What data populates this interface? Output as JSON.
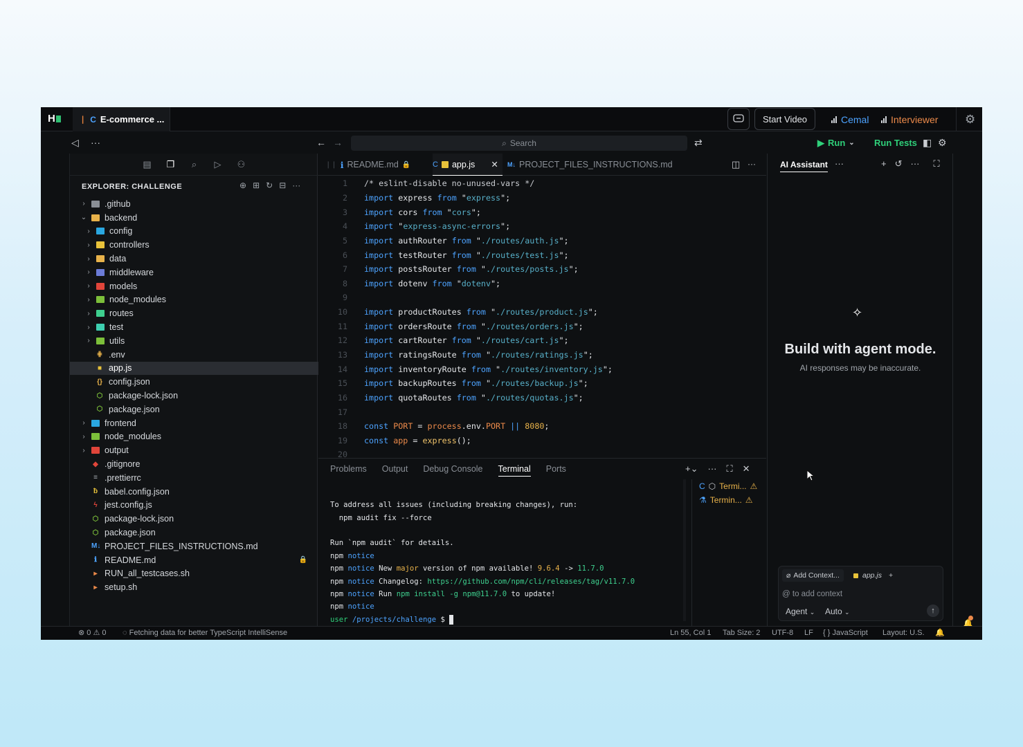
{
  "window": {
    "project_tab": "E-commerce ...",
    "start_video": "Start Video",
    "user1": "Cemal",
    "user2": "Interviewer",
    "colors": {
      "user1": "#4da3ff",
      "user2": "#ec8a4a",
      "run": "#2fd07a"
    }
  },
  "toolbar": {
    "search_placeholder": "Search",
    "run_label": "Run",
    "run_tests_label": "Run Tests"
  },
  "explorer": {
    "title": "EXPLORER: CHALLENGE",
    "items": [
      {
        "label": ".github",
        "depth": 0,
        "type": "folder",
        "expanded": false,
        "color": "#8a8f96"
      },
      {
        "label": "backend",
        "depth": 0,
        "type": "folder",
        "expanded": true,
        "color": "#e8b24a"
      },
      {
        "label": "config",
        "depth": 1,
        "type": "folder",
        "expanded": false,
        "color": "#2aa7e0"
      },
      {
        "label": "controllers",
        "depth": 1,
        "type": "folder",
        "expanded": false,
        "color": "#e8c23a"
      },
      {
        "label": "data",
        "depth": 1,
        "type": "folder",
        "expanded": false,
        "color": "#e8b24a"
      },
      {
        "label": "middleware",
        "depth": 1,
        "type": "folder",
        "expanded": false,
        "color": "#6b7bd6"
      },
      {
        "label": "models",
        "depth": 1,
        "type": "folder",
        "expanded": false,
        "color": "#e0453a"
      },
      {
        "label": "node_modules",
        "depth": 1,
        "type": "folder",
        "expanded": false,
        "color": "#7cbf3a"
      },
      {
        "label": "routes",
        "depth": 1,
        "type": "folder",
        "expanded": false,
        "color": "#3ecf8e"
      },
      {
        "label": "test",
        "depth": 1,
        "type": "folder",
        "expanded": false,
        "color": "#3ecfb0"
      },
      {
        "label": "utils",
        "depth": 1,
        "type": "folder",
        "expanded": false,
        "color": "#7cbf3a"
      },
      {
        "label": ".env",
        "depth": 1,
        "type": "file",
        "glyph": "⋕",
        "color": "#e8b24a"
      },
      {
        "label": "app.js",
        "depth": 1,
        "type": "file",
        "glyph": "■",
        "color": "#e8c23a",
        "selected": true
      },
      {
        "label": "config.json",
        "depth": 1,
        "type": "file",
        "glyph": "{}",
        "color": "#e8b24a"
      },
      {
        "label": "package-lock.json",
        "depth": 1,
        "type": "file",
        "glyph": "⬡",
        "color": "#7cbf3a"
      },
      {
        "label": "package.json",
        "depth": 1,
        "type": "file",
        "glyph": "⬡",
        "color": "#7cbf3a"
      },
      {
        "label": "frontend",
        "depth": 0,
        "type": "folder",
        "expanded": false,
        "color": "#2aa7e0"
      },
      {
        "label": "node_modules",
        "depth": 0,
        "type": "folder",
        "expanded": false,
        "color": "#7cbf3a"
      },
      {
        "label": "output",
        "depth": 0,
        "type": "folder",
        "expanded": false,
        "color": "#e0453a"
      },
      {
        "label": ".gitignore",
        "depth": 0,
        "type": "file",
        "glyph": "◆",
        "color": "#e0453a"
      },
      {
        "label": ".prettierrc",
        "depth": 0,
        "type": "file",
        "glyph": "≡",
        "color": "#a0a5ab"
      },
      {
        "label": "babel.config.json",
        "depth": 0,
        "type": "file",
        "glyph": "ƀ",
        "color": "#e8c23a"
      },
      {
        "label": "jest.config.js",
        "depth": 0,
        "type": "file",
        "glyph": "ϟ",
        "color": "#e0453a"
      },
      {
        "label": "package-lock.json",
        "depth": 0,
        "type": "file",
        "glyph": "⬡",
        "color": "#7cbf3a"
      },
      {
        "label": "package.json",
        "depth": 0,
        "type": "file",
        "glyph": "⬡",
        "color": "#7cbf3a"
      },
      {
        "label": "PROJECT_FILES_INSTRUCTIONS.md",
        "depth": 0,
        "type": "file",
        "glyph": "M↓",
        "color": "#4da3ff"
      },
      {
        "label": "README.md",
        "depth": 0,
        "type": "file",
        "glyph": "ℹ",
        "color": "#4da3ff",
        "locked": true
      },
      {
        "label": "RUN_all_testcases.sh",
        "depth": 0,
        "type": "file",
        "glyph": "▸",
        "color": "#ec8a4a"
      },
      {
        "label": "setup.sh",
        "depth": 0,
        "type": "file",
        "glyph": "▸",
        "color": "#ec8a4a"
      }
    ]
  },
  "editor": {
    "tabs": [
      {
        "label": "README.md",
        "active": false
      },
      {
        "label": "app.js",
        "active": true
      },
      {
        "label": "PROJECT_FILES_INSTRUCTIONS.md",
        "active": false
      }
    ],
    "lines": [
      [
        [
          "cm",
          "/* eslint-disable no-unused-vars */"
        ]
      ],
      [
        [
          "kw",
          "import"
        ],
        [
          "tx",
          " express "
        ],
        [
          "kw",
          "from"
        ],
        [
          "tx",
          " \""
        ],
        [
          "st",
          "express"
        ],
        [
          "tx",
          "\";"
        ]
      ],
      [
        [
          "kw",
          "import"
        ],
        [
          "tx",
          " cors "
        ],
        [
          "kw",
          "from"
        ],
        [
          "tx",
          " \""
        ],
        [
          "st",
          "cors"
        ],
        [
          "tx",
          "\";"
        ]
      ],
      [
        [
          "kw",
          "import"
        ],
        [
          "tx",
          " \""
        ],
        [
          "st",
          "express-async-errors"
        ],
        [
          "tx",
          "\";"
        ]
      ],
      [
        [
          "kw",
          "import"
        ],
        [
          "tx",
          " authRouter "
        ],
        [
          "kw",
          "from"
        ],
        [
          "tx",
          " \""
        ],
        [
          "st",
          "./routes/auth.js"
        ],
        [
          "tx",
          "\";"
        ]
      ],
      [
        [
          "kw",
          "import"
        ],
        [
          "tx",
          " testRouter "
        ],
        [
          "kw",
          "from"
        ],
        [
          "tx",
          " \""
        ],
        [
          "st",
          "./routes/test.js"
        ],
        [
          "tx",
          "\";"
        ]
      ],
      [
        [
          "kw",
          "import"
        ],
        [
          "tx",
          " postsRouter "
        ],
        [
          "kw",
          "from"
        ],
        [
          "tx",
          " \""
        ],
        [
          "st",
          "./routes/posts.js"
        ],
        [
          "tx",
          "\";"
        ]
      ],
      [
        [
          "kw",
          "import"
        ],
        [
          "tx",
          " dotenv "
        ],
        [
          "kw",
          "from"
        ],
        [
          "tx",
          " \""
        ],
        [
          "st",
          "dotenv"
        ],
        [
          "tx",
          "\";"
        ]
      ],
      [],
      [
        [
          "kw",
          "import"
        ],
        [
          "tx",
          " productRoutes "
        ],
        [
          "kw",
          "from"
        ],
        [
          "tx",
          " \""
        ],
        [
          "st",
          "./routes/product.js"
        ],
        [
          "tx",
          "\";"
        ]
      ],
      [
        [
          "kw",
          "import"
        ],
        [
          "tx",
          " ordersRoute "
        ],
        [
          "kw",
          "from"
        ],
        [
          "tx",
          " \""
        ],
        [
          "st",
          "./routes/orders.js"
        ],
        [
          "tx",
          "\";"
        ]
      ],
      [
        [
          "kw",
          "import"
        ],
        [
          "tx",
          " cartRouter "
        ],
        [
          "kw",
          "from"
        ],
        [
          "tx",
          " \""
        ],
        [
          "st",
          "./routes/cart.js"
        ],
        [
          "tx",
          "\";"
        ]
      ],
      [
        [
          "kw",
          "import"
        ],
        [
          "tx",
          " ratingsRoute "
        ],
        [
          "kw",
          "from"
        ],
        [
          "tx",
          " \""
        ],
        [
          "st",
          "./routes/ratings.js"
        ],
        [
          "tx",
          "\";"
        ]
      ],
      [
        [
          "kw",
          "import"
        ],
        [
          "tx",
          " inventoryRoute "
        ],
        [
          "kw",
          "from"
        ],
        [
          "tx",
          " \""
        ],
        [
          "st",
          "./routes/inventory.js"
        ],
        [
          "tx",
          "\";"
        ]
      ],
      [
        [
          "kw",
          "import"
        ],
        [
          "tx",
          " backupRoutes "
        ],
        [
          "kw",
          "from"
        ],
        [
          "tx",
          " \""
        ],
        [
          "st",
          "./routes/backup.js"
        ],
        [
          "tx",
          "\";"
        ]
      ],
      [
        [
          "kw",
          "import"
        ],
        [
          "tx",
          " quotaRoutes "
        ],
        [
          "kw",
          "from"
        ],
        [
          "tx",
          " \""
        ],
        [
          "st",
          "./routes/quotas.js"
        ],
        [
          "tx",
          "\";"
        ]
      ],
      [],
      [
        [
          "kw",
          "const"
        ],
        [
          "or",
          " PORT"
        ],
        [
          "tx",
          " = "
        ],
        [
          "or",
          "process"
        ],
        [
          "tx",
          ".env."
        ],
        [
          "or",
          "PORT"
        ],
        [
          "kw",
          " ||"
        ],
        [
          "nm",
          " 8080"
        ],
        [
          "tx",
          ";"
        ]
      ],
      [
        [
          "kw",
          "const"
        ],
        [
          "or",
          " app"
        ],
        [
          "tx",
          " = "
        ],
        [
          "fn",
          "express"
        ],
        [
          "tx",
          "();"
        ]
      ],
      []
    ]
  },
  "panel": {
    "tabs": [
      "Problems",
      "Output",
      "Debug Console",
      "Terminal",
      "Ports"
    ],
    "active_tab": "Terminal",
    "terminal_lines": [
      [
        [
          "tx",
          "To address all issues (including breaking changes), run:"
        ]
      ],
      [
        [
          "tx",
          "  npm audit fix --force"
        ]
      ],
      [],
      [
        [
          "tx",
          "Run `npm audit` for details."
        ]
      ],
      [
        [
          "tx",
          "npm "
        ],
        [
          "tlk",
          "notice"
        ]
      ],
      [
        [
          "tx",
          "npm "
        ],
        [
          "tlk",
          "notice"
        ],
        [
          "tx",
          " New "
        ],
        [
          "or",
          "major"
        ],
        [
          "tx",
          " version of npm available! "
        ],
        [
          "or",
          "9.6.4"
        ],
        [
          "tx",
          " -> "
        ],
        [
          "tgrn",
          "11.7.0"
        ]
      ],
      [
        [
          "tx",
          "npm "
        ],
        [
          "tlk",
          "notice"
        ],
        [
          "tx",
          " Changelog: "
        ],
        [
          "tgrn",
          "https://github.com/npm/cli/releases/tag/v11.7.0"
        ]
      ],
      [
        [
          "tx",
          "npm "
        ],
        [
          "tlk",
          "notice"
        ],
        [
          "tx",
          " Run "
        ],
        [
          "tgrn",
          "npm install -g npm@11.7.0"
        ],
        [
          "tx",
          " to update!"
        ]
      ],
      [
        [
          "tx",
          "npm "
        ],
        [
          "tlk",
          "notice"
        ]
      ],
      [
        [
          "tg",
          "user"
        ],
        [
          "tlk",
          " /projects/challenge"
        ],
        [
          "tx",
          " $ "
        ]
      ]
    ],
    "terminals": [
      "Termi...",
      "Termin..."
    ]
  },
  "ai": {
    "tab": "AI Assistant",
    "title": "Build with agent mode.",
    "subtitle": "AI responses may be inaccurate.",
    "add_context": "Add Context...",
    "context_file": "app.js",
    "placeholder": "@ to add context",
    "mode": "Agent",
    "model": "Auto"
  },
  "status": {
    "errors": "0",
    "warnings": "0",
    "message": "Fetching data for better TypeScript IntelliSense",
    "position": "Ln 55, Col 1",
    "tab_size": "Tab Size: 2",
    "encoding": "UTF-8",
    "eol": "LF",
    "language": "JavaScript",
    "layout": "Layout: U.S."
  }
}
